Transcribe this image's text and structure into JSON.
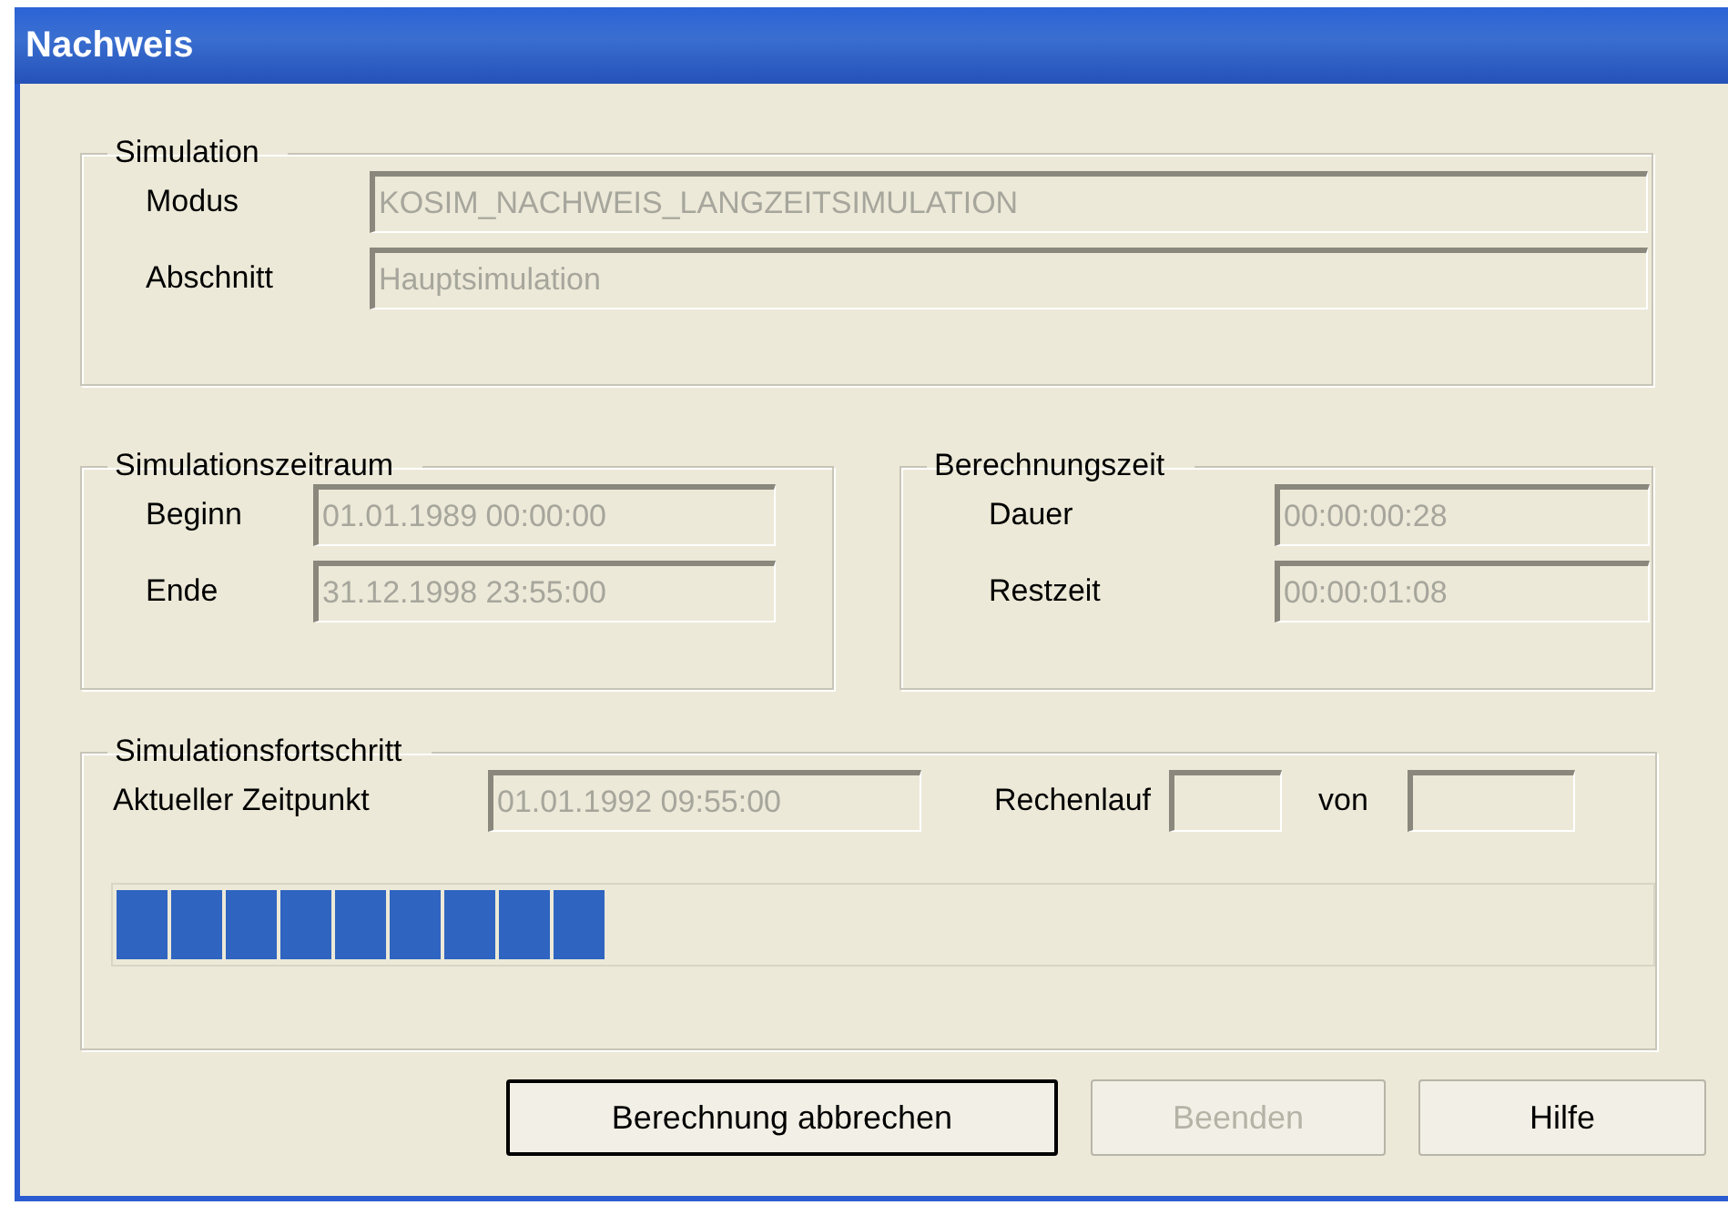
{
  "window": {
    "title": "Nachweis"
  },
  "simulation": {
    "title": "Simulation",
    "fields": [
      {
        "label": "Modus",
        "value": "KOSIM_NACHWEIS_LANGZEITSIMULATION",
        "disabled": true
      },
      {
        "label": "Abschnitt",
        "value": "Hauptsimulation",
        "disabled": true
      }
    ]
  },
  "zeitraum": {
    "title": "Simulationszeitraum",
    "fields": [
      {
        "label": "Beginn",
        "value": "01.01.1989 00:00:00",
        "disabled": true
      },
      {
        "label": "Ende",
        "value": "31.12.1998 23:55:00",
        "disabled": true
      }
    ]
  },
  "berechnungszeit": {
    "title": "Berechnungszeit",
    "fields": [
      {
        "label": "Dauer",
        "value": "00:00:00:28",
        "disabled": true
      },
      {
        "label": "Restzeit",
        "value": "00:00:01:08",
        "disabled": true
      }
    ]
  },
  "fortschritt": {
    "title": "Simulationsfortschritt",
    "zeitpunkt": {
      "label": "Aktueller Zeitpunkt",
      "value": "01.01.1992 09:55:00",
      "disabled": true
    },
    "rechenlauf": {
      "label": "Rechenlauf"
    },
    "von": {
      "label": "von"
    },
    "progress": {
      "level": 0.32
    }
  },
  "buttons": [
    {
      "label": "Berechnung abbrechen",
      "disabled": false,
      "default": true
    },
    {
      "label": "Beenden",
      "disabled": true,
      "default": false
    },
    {
      "label": "Hilfe",
      "disabled": false,
      "default": false
    }
  ]
}
